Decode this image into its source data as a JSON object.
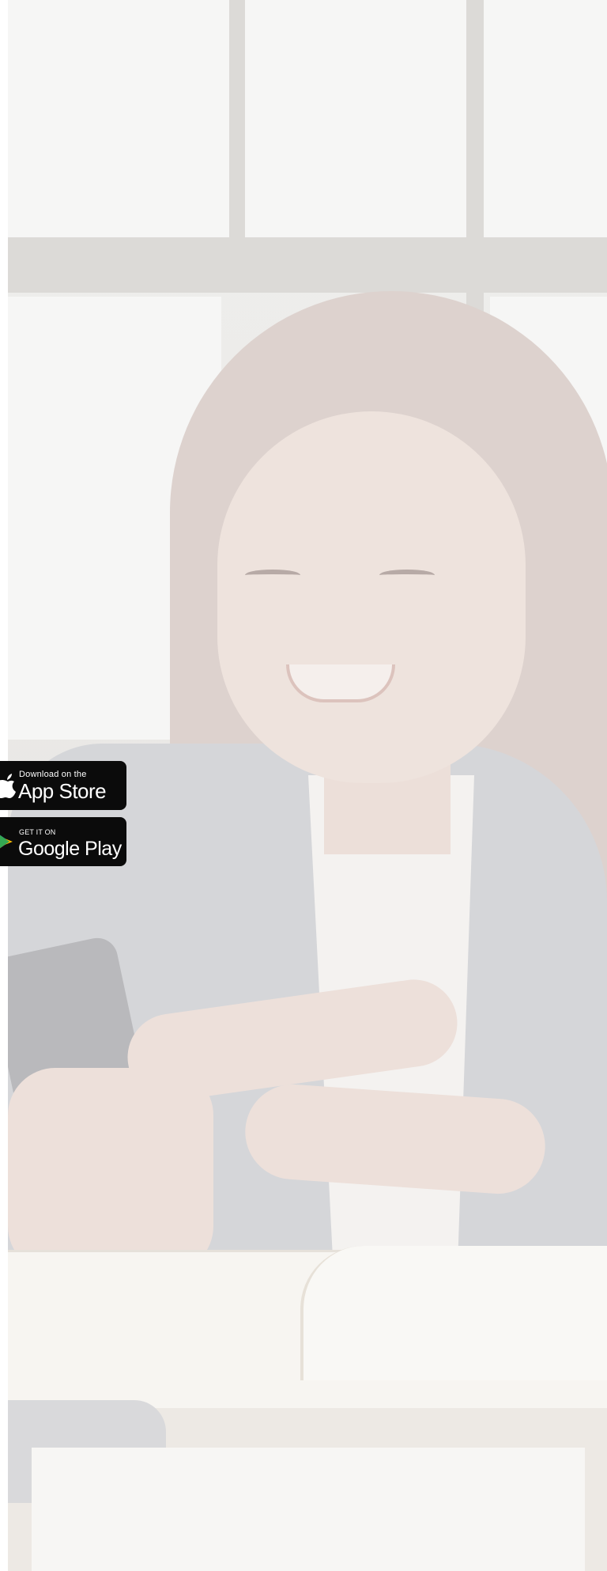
{
  "badges": {
    "app_store": {
      "small_text": "Download on the",
      "large_text": "App Store",
      "icon": "apple-icon"
    },
    "google_play": {
      "small_text": "GET IT ON",
      "large_text": "Google Play",
      "icon": "google-play-icon"
    }
  },
  "colors": {
    "badge_background": "#0b0b0b",
    "badge_text": "#ffffff",
    "page_background": "#ffffff"
  }
}
